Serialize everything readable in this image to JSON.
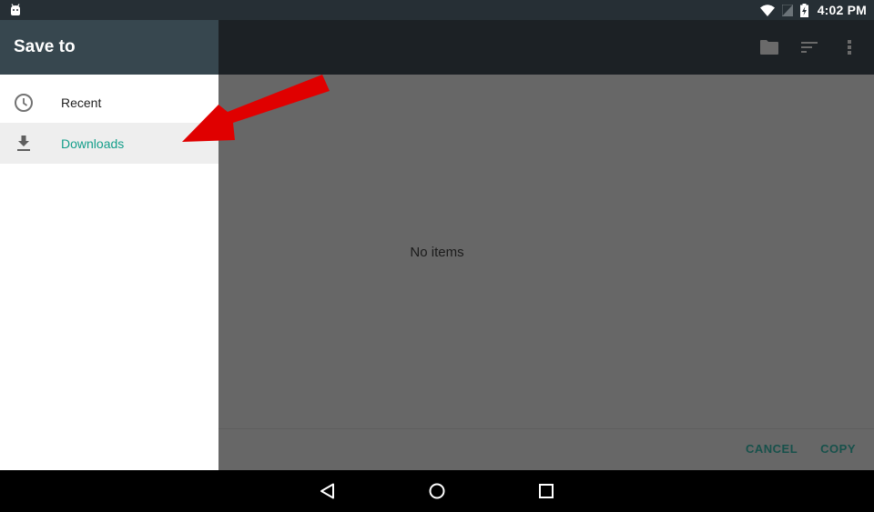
{
  "status_bar": {
    "time": "4:02 PM",
    "icons": [
      "android-debug-icon",
      "wifi-icon",
      "no-signal-icon",
      "battery-charging-icon"
    ]
  },
  "app_bar": {
    "actions": [
      "new-folder-icon",
      "sort-icon",
      "more-vert-icon"
    ]
  },
  "drawer": {
    "title": "Save to",
    "items": [
      {
        "label": "Recent",
        "icon": "clock-icon",
        "selected": false
      },
      {
        "label": "Downloads",
        "icon": "download-icon",
        "selected": true
      }
    ]
  },
  "content": {
    "empty_message": "No items",
    "buttons": {
      "cancel": "CANCEL",
      "copy": "COPY"
    }
  },
  "nav_bar": {
    "buttons": [
      "back-icon",
      "home-icon",
      "recents-icon"
    ]
  },
  "colors": {
    "accent": "#139e8a",
    "drawer_header": "#37474f",
    "button_text": "#17514b",
    "annotation_arrow": "#e00000"
  }
}
